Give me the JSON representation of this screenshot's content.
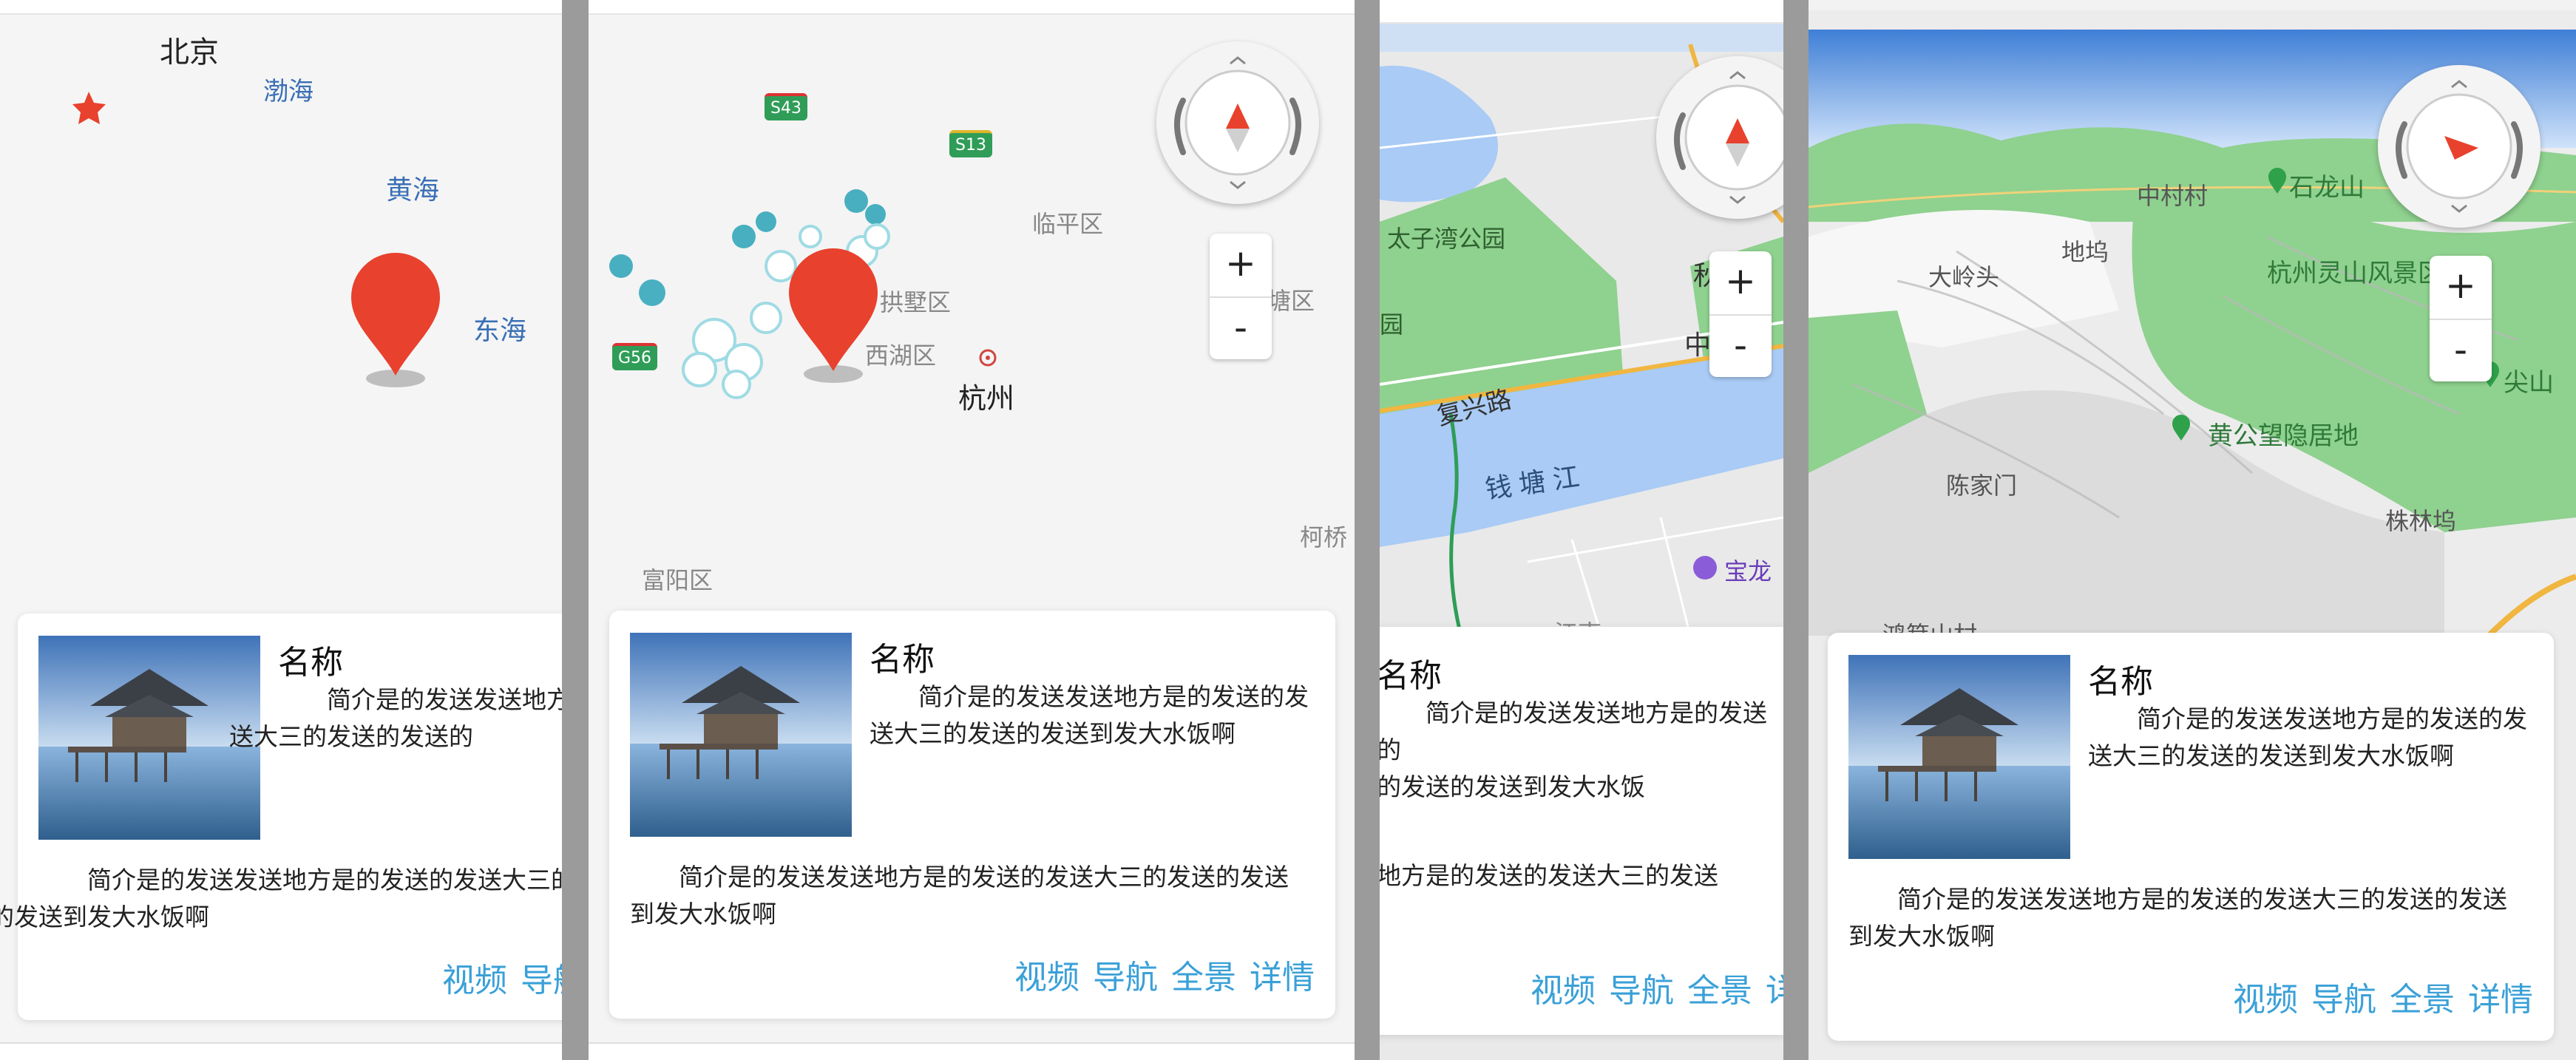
{
  "colors": {
    "accent": "#3aa0d8",
    "pin": "#e8412d",
    "water": "#a9cbf5",
    "green": "#8fd18f",
    "land": "#f5f5f5"
  },
  "panel1": {
    "map_labels": {
      "beijing": "北京",
      "bohai": "渤海",
      "huanghai": "黄海",
      "donghai": "东海"
    },
    "card": {
      "name": "名称",
      "brief": "简介是的发送发送地方",
      "brief2": "送大三的发送的发送的",
      "description": "简介是的发送发送地方是的发送的发送大三的",
      "description2": "的发送到发大水饭啊",
      "actions": [
        "视频",
        "导航"
      ]
    }
  },
  "panel2": {
    "map_labels": {
      "s43": "S43",
      "s13": "S13",
      "g56": "G56",
      "linping": "临平区",
      "gongshu": "拱墅区",
      "xihu": "西湖区",
      "hangzhou": "杭州",
      "fuyang": "富阳区",
      "keqiao": "柯桥",
      "tang": "塘区"
    },
    "zoom": {
      "plus": "+",
      "minus": "-"
    },
    "card": {
      "name": "名称",
      "brief": "简介是的发送发送地方是的发送的发送大三的发送的发送到发大水饭啊",
      "description": "简介是的发送发送地方是的发送的发送大三的发送的发送到发大水饭啊",
      "actions": [
        "视频",
        "导航",
        "全景",
        "详情"
      ]
    }
  },
  "panel3": {
    "map_labels": {
      "taiziwan": "太子湾公园",
      "fuxinglu": "复兴路",
      "qiantangjiang": "钱塘江",
      "baolong": "宝龙",
      "jiangnan": "江南",
      "yuan": "园",
      "zhong": "中",
      "qiu": "秋"
    },
    "zoom": {
      "plus": "+",
      "minus": "-"
    },
    "card": {
      "name": "名称",
      "brief": "简介是的发送发送地方是的发送的",
      "brief2": "大三的发送的发送到发大水饭",
      "description": "地方是的发送的发送大三的发送",
      "actions": [
        "视频",
        "导航",
        "全景",
        "详"
      ]
    }
  },
  "panel4": {
    "map_labels": {
      "zhongcun": "中村村",
      "shilong": "石龙山",
      "dalingtou": "大岭头",
      "diwu": "地坞",
      "lingshan": "杭州灵山风景区",
      "jianshan": "尖山",
      "huanggong": "黄公望隐居地",
      "chenjiamen": "陈家门",
      "zhulinwu": "株林坞",
      "qiaojiacun": "鸿箕山村"
    },
    "zoom": {
      "plus": "+",
      "minus": "-"
    },
    "card": {
      "name": "名称",
      "brief": "简介是的发送发送地方是的发送的发送大三的发送的发送到发大水饭啊",
      "description": "简介是的发送发送地方是的发送的发送大三的发送的发送到发大水饭啊",
      "actions": [
        "视频",
        "导航",
        "全景",
        "详情"
      ]
    }
  }
}
